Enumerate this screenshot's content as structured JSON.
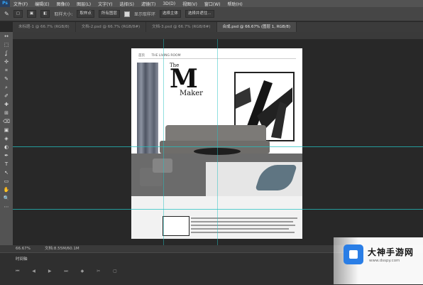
{
  "app_logo": "Ps",
  "menus": [
    "文件(F)",
    "编辑(E)",
    "图像(I)",
    "图层(L)",
    "文字(Y)",
    "选择(S)",
    "滤镜(T)",
    "3D(D)",
    "视图(V)",
    "窗口(W)",
    "帮助(H)"
  ],
  "options": {
    "sample_label": "取样大小:",
    "sample_value": "取样点",
    "sample_select": "所有图层",
    "show_ring": "显示取样环",
    "select_subject": "选择主体",
    "select_and_mask": "选择并遮住..."
  },
  "tabs": [
    {
      "label": "未标题-1 @ 66.7% (RGB/8)"
    },
    {
      "label": "文档-2.psd @ 66.7% (RGB/8#)"
    },
    {
      "label": "文档-3.psd @ 66.7% (RGB/8#)"
    },
    {
      "label": "合成.psd @ 66.67% (图层 1, RGB/8)"
    }
  ],
  "tools": [
    "↔",
    "⬚",
    "ʆ",
    "✣",
    "⌗",
    "✎",
    "⌕",
    "✐",
    "✚",
    "⊞",
    "⌫",
    "▣",
    "◈",
    "◐",
    "✒",
    "T",
    "↖",
    "▭",
    "✋",
    "🔍",
    "⋯"
  ],
  "doc": {
    "nav_items": [
      "首页",
      "THE LIVING ROOM"
    ],
    "title_line1": "The",
    "title_big": "M",
    "title_line2": "Maker"
  },
  "status": {
    "zoom": "66.67%",
    "doc_size": "文档:8.55M/60.1M"
  },
  "timeline": {
    "label": "时间轴",
    "controls": "⏮ ◀ ▶ ⏭ ◆ ✂ ▢"
  },
  "watermark": {
    "name": "大神手游网",
    "url": "www.dsspy.com"
  },
  "colors": {
    "accent": "#31a8ff",
    "guide": "#23c2c2",
    "watermark_blue": "#2a7ee6"
  }
}
